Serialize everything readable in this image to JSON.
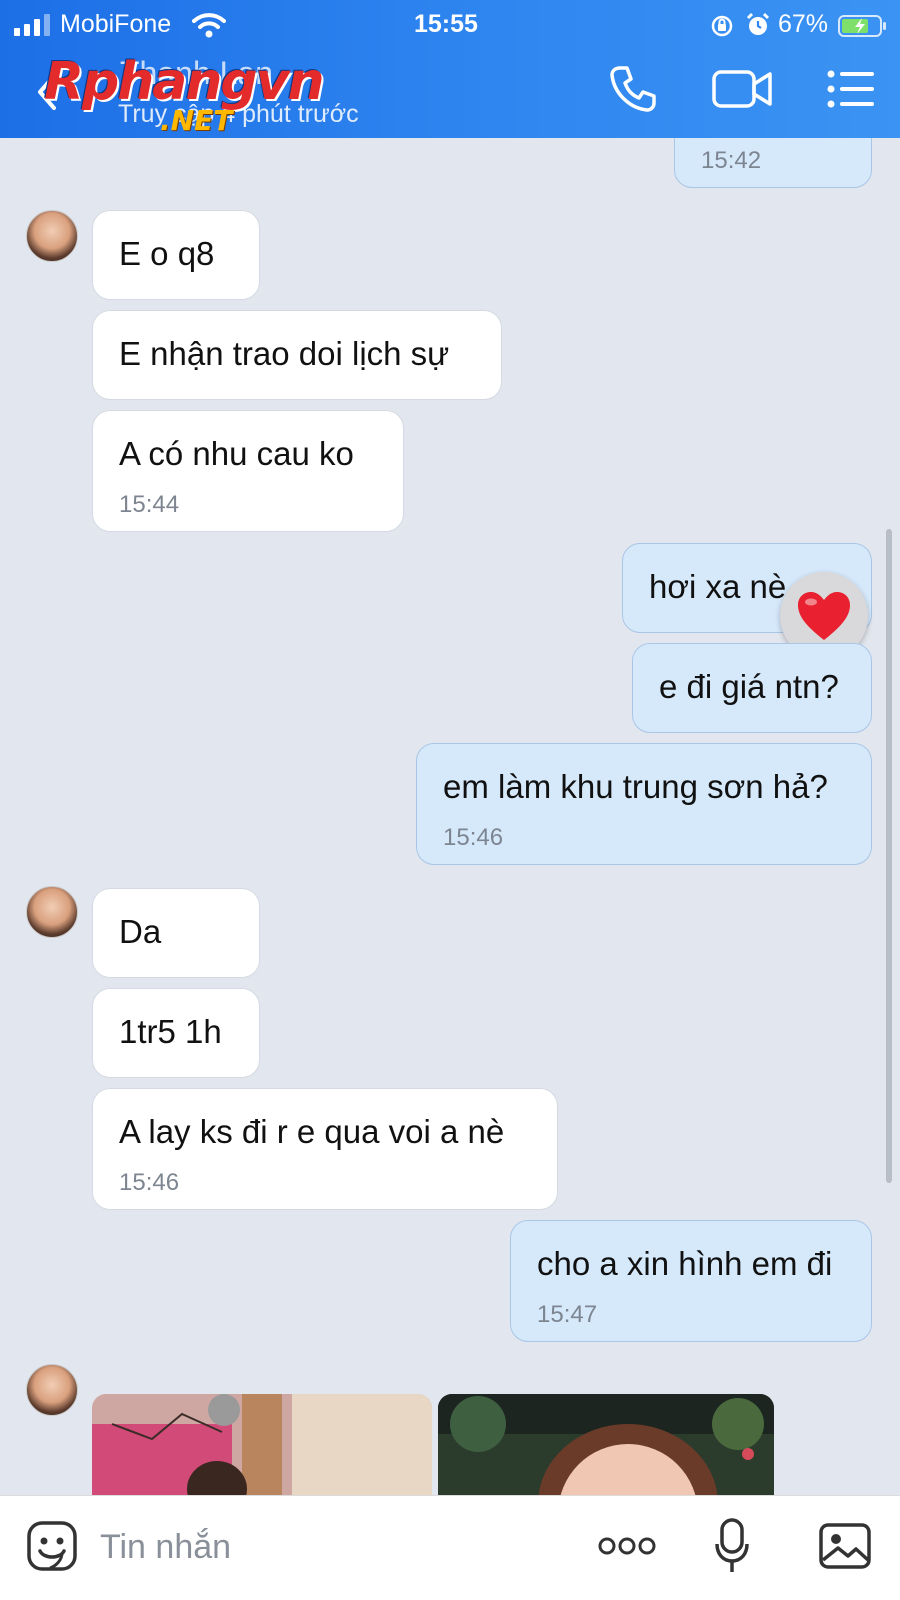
{
  "status_bar": {
    "carrier": "MobiFone",
    "time": "15:55",
    "battery": "67%"
  },
  "header": {
    "contact_name": "Thanh Lan",
    "contact_status": "Truy cập 4 phút trước",
    "watermark": "Rphangvn",
    "watermark_suffix": ".NET"
  },
  "messages": [
    {
      "from": "me",
      "time": "15:42"
    },
    {
      "from": "them",
      "text": "E o q8"
    },
    {
      "from": "them",
      "text": "E nhận trao doi lịch sự"
    },
    {
      "from": "them",
      "text": "A có nhu cau ko",
      "time": "15:44"
    },
    {
      "from": "me",
      "text": "hơi xa nè",
      "reaction": "heart"
    },
    {
      "from": "me",
      "text": "e đi giá ntn?"
    },
    {
      "from": "me",
      "text": "em làm khu trung sơn hả?",
      "time": "15:46"
    },
    {
      "from": "them",
      "text": "Da"
    },
    {
      "from": "them",
      "text": "1tr5 1h"
    },
    {
      "from": "them",
      "text": "A lay ks đi r e qua voi a nè",
      "time": "15:46"
    },
    {
      "from": "me",
      "text": "cho a xin hình em đi",
      "time": "15:47"
    }
  ],
  "composer": {
    "placeholder": "Tin nhắn"
  },
  "colors": {
    "header_start": "#1d6fe6",
    "header_end": "#3b93f3",
    "outgoing_bubble": "#d6e9fb",
    "incoming_bubble": "#ffffff",
    "chat_background": "#e2e6ee"
  }
}
